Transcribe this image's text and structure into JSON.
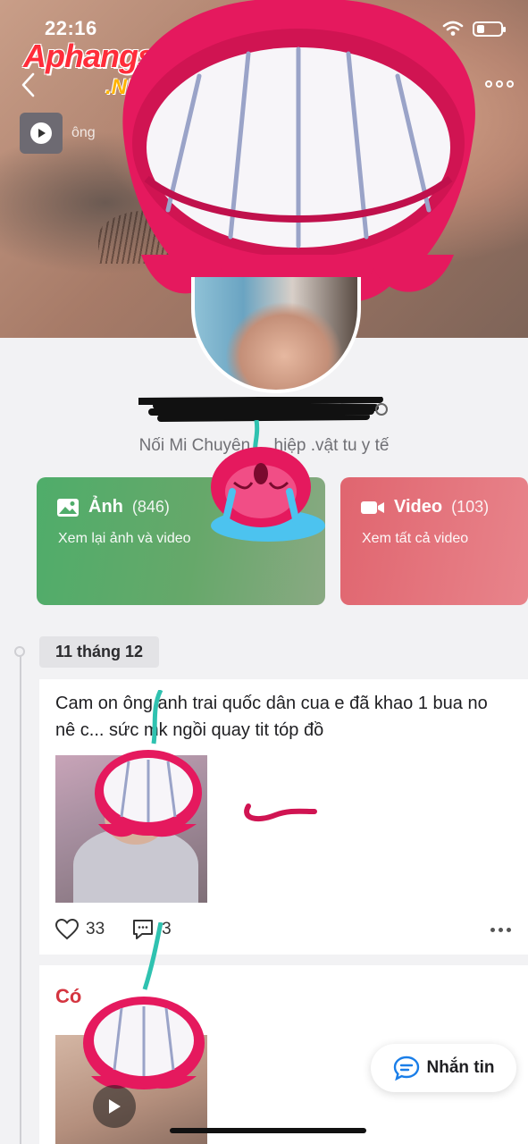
{
  "status_bar": {
    "time": "22:16"
  },
  "watermark": {
    "brand": "Aphangs",
    "suffix": ".NET"
  },
  "cover": {
    "music_label": "ông"
  },
  "profile": {
    "bio": "Nối Mi Chuyên ... hiệp .vật tu y tế"
  },
  "media_cards": [
    {
      "title": "Ảnh",
      "count": "(846)",
      "subtitle": "Xem lại ảnh và video",
      "icon": "image-icon"
    },
    {
      "title": "Video",
      "count": "(103)",
      "subtitle": "Xem tất cả video",
      "icon": "video-camera-icon"
    }
  ],
  "timeline": {
    "date": "11 tháng 12"
  },
  "post": {
    "text": "Cam on ông anh trai quốc dân cua e đã khao 1 bua no nê c... sức mk ngồi quay tit tóp đồ",
    "likes": "33",
    "comments": "3"
  },
  "post2": {
    "title_visible": "Có"
  },
  "message_button": {
    "label": "Nhắn tin"
  },
  "colors": {
    "photo_card": "#4fad6a",
    "video_card": "#e0656f",
    "sticker_red": "#e5195e",
    "message_icon": "#1a7ee8"
  }
}
